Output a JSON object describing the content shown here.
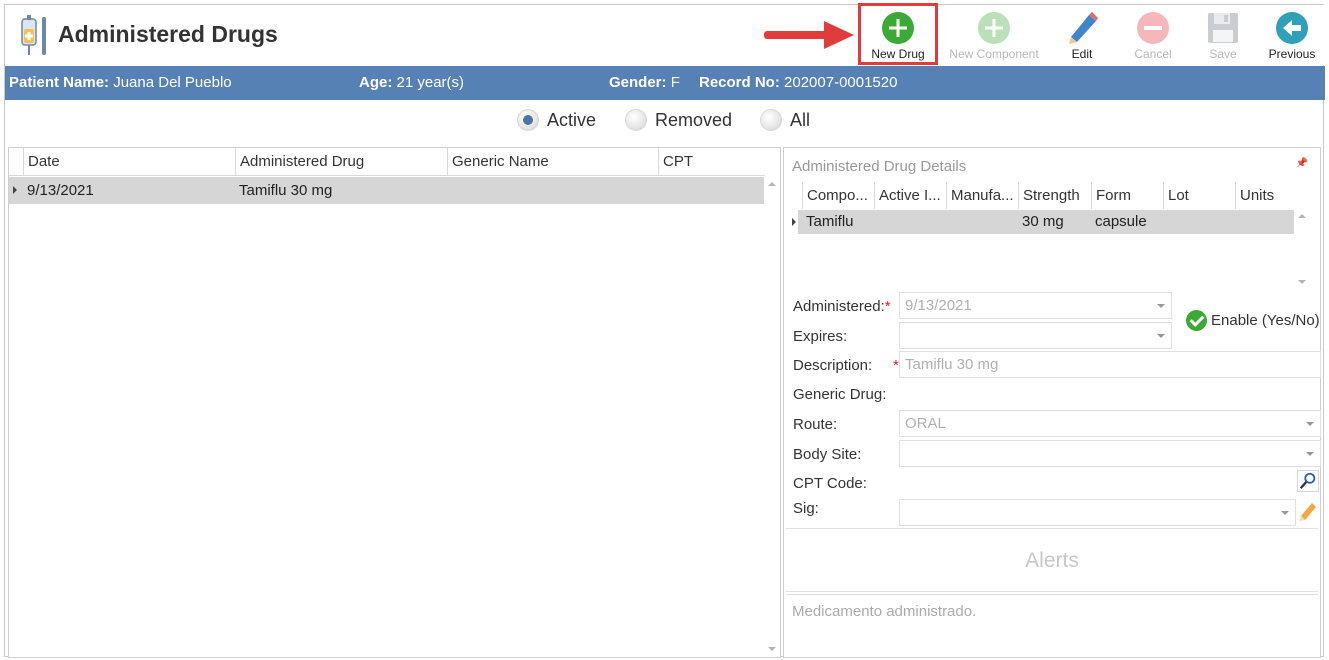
{
  "header": {
    "title": "Administered Drugs",
    "icons": {
      "app": "iv-drip-icon"
    }
  },
  "toolbar": {
    "new_drug": "New Drug",
    "new_component": "New Component",
    "edit": "Edit",
    "cancel": "Cancel",
    "save": "Save",
    "previous": "Previous"
  },
  "patient": {
    "name_label": "Patient Name:",
    "name": "Juana Del Pueblo",
    "age_label": "Age:",
    "age": "21 year(s)",
    "gender_label": "Gender:",
    "gender": "F",
    "record_label": "Record No:",
    "record": "202007-0001520"
  },
  "filter": {
    "options": [
      "Active",
      "Removed",
      "All"
    ],
    "selected": "Active"
  },
  "drugs_grid": {
    "columns": [
      "Date",
      "Administered Drug",
      "Generic Name",
      "CPT"
    ],
    "rows": [
      {
        "date": "9/13/2021",
        "drug": "Tamiflu 30 mg",
        "generic": "",
        "cpt": ""
      }
    ]
  },
  "details": {
    "title": "Administered Drug Details",
    "components": {
      "columns": [
        "Compo...",
        "Active I...",
        "Manufa...",
        "Strength",
        "Form",
        "Lot",
        "Units"
      ],
      "rows": [
        {
          "component": "Tamiflu",
          "active": "",
          "manufacturer": "",
          "strength": "30 mg",
          "form": "capsule",
          "lot": "",
          "units": ""
        }
      ]
    },
    "form": {
      "administered_label": "Administered:",
      "administered_value": "9/13/2021",
      "expires_label": "Expires:",
      "expires_value": "",
      "enable_label": "Enable (Yes/No)",
      "description_label": "Description:",
      "description_value": "Tamiflu 30 mg",
      "generic_label": "Generic Drug:",
      "route_label": "Route:",
      "route_value": "ORAL",
      "body_site_label": "Body Site:",
      "body_site_value": "",
      "cpt_label": "CPT Code:",
      "sig_label": "Sig:",
      "sig_value": ""
    },
    "alerts_title": "Alerts",
    "note": "Medicamento administrado."
  },
  "colors": {
    "patient_bar": "#5681b5",
    "highlight": "#e23b3b",
    "new_green": "#3aaa35",
    "cancel_red": "#e85a60",
    "previous_teal": "#2fa0b8",
    "row_selected": "#d6d6d6"
  }
}
